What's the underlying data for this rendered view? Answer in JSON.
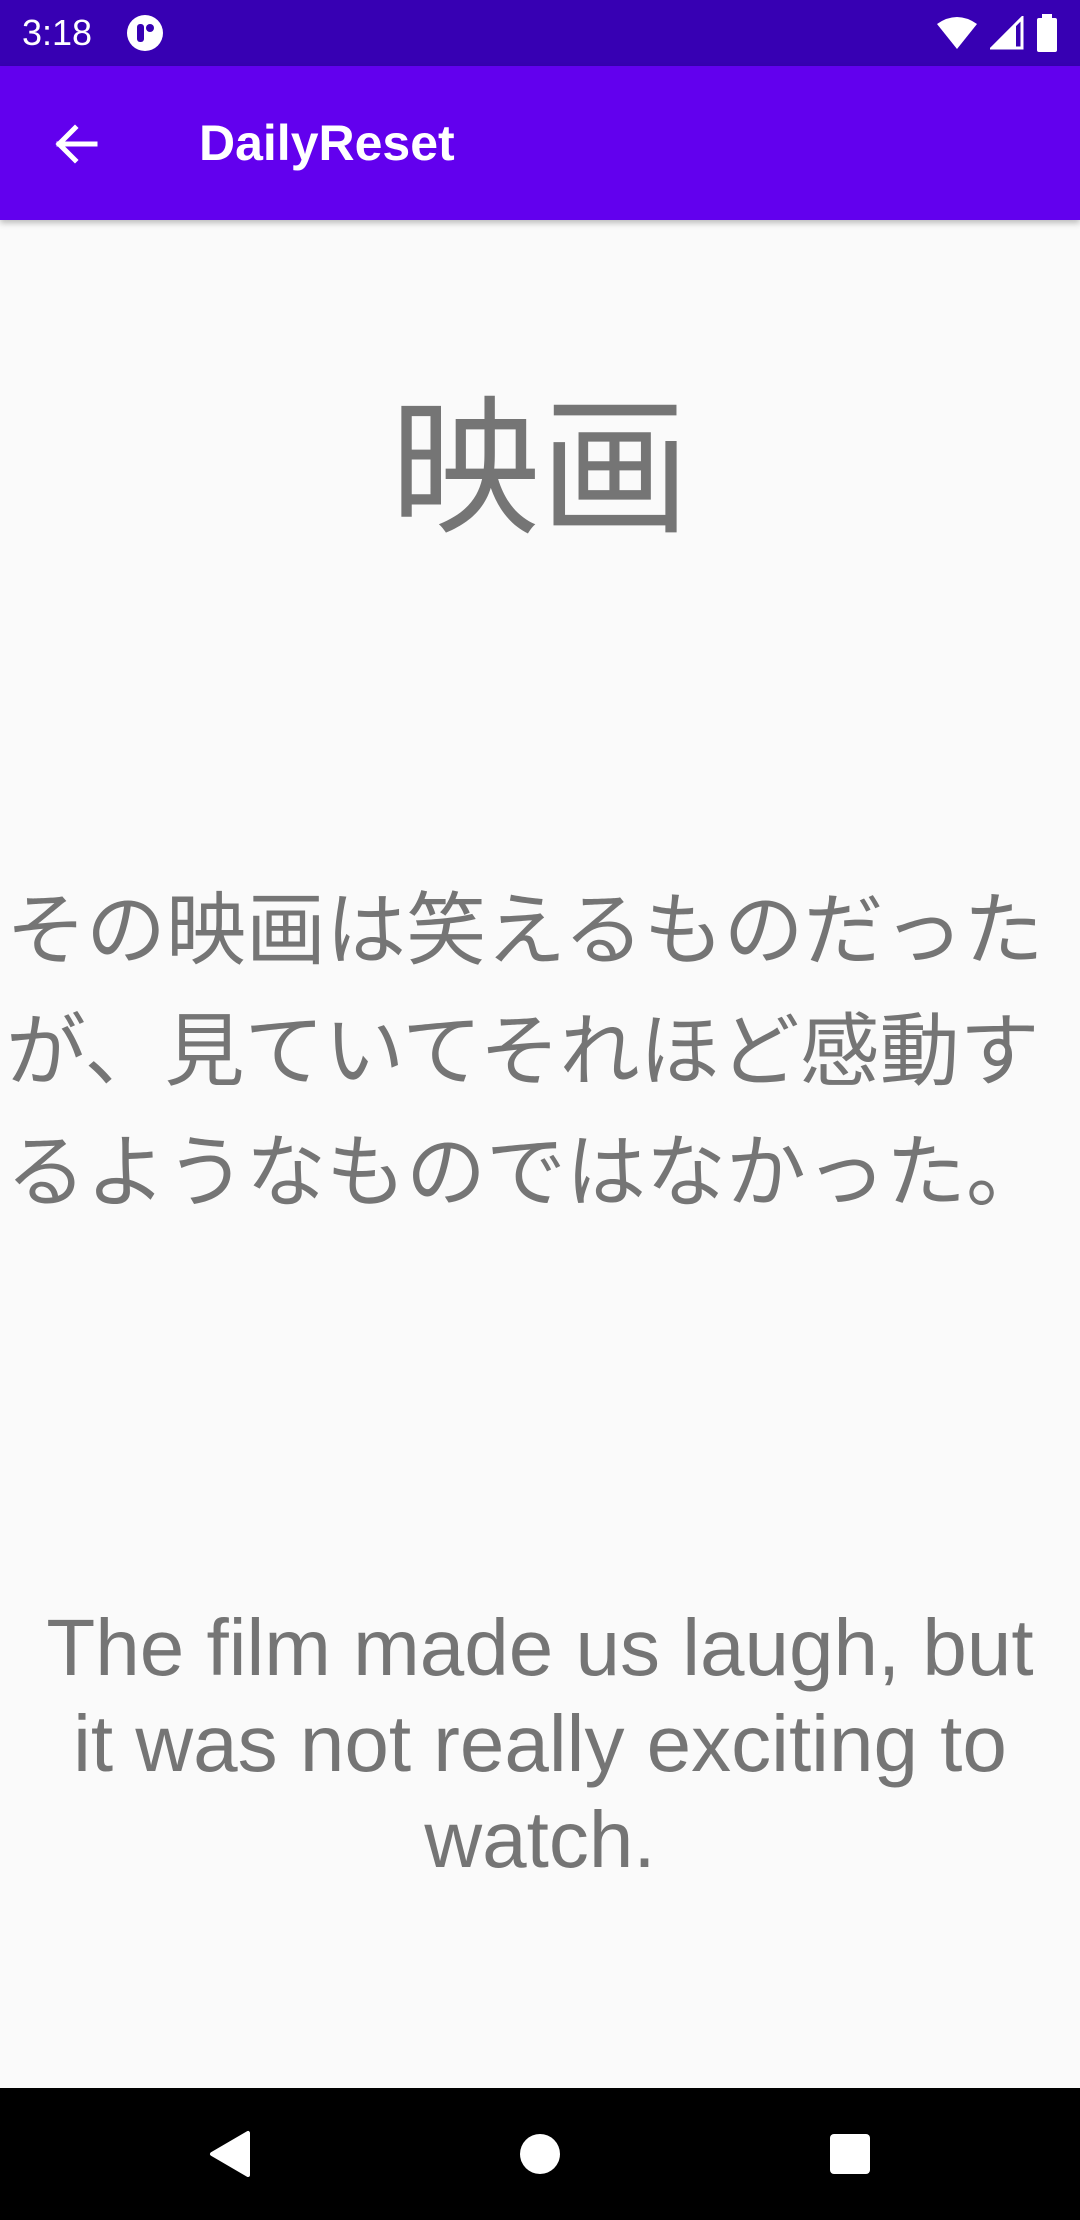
{
  "status_bar": {
    "time": "3:18",
    "icons": [
      "app-notification-icon",
      "wifi-icon",
      "signal-icon",
      "battery-icon"
    ]
  },
  "app_bar": {
    "title": "DailyReset",
    "back_icon": "arrow-back-icon"
  },
  "card": {
    "word": "映画",
    "sentence_jp": "その映画は笑えるものだったが、見ていてそれほど感動するようなものではなかった。",
    "sentence_en": "The film made us laugh, but it was not really exciting to watch."
  },
  "nav_bar": {
    "icons": [
      "back-triangle-icon",
      "home-circle-icon",
      "recents-square-icon"
    ]
  },
  "colors": {
    "status_bar": "#3700b3",
    "app_bar": "#6200ee",
    "background": "#fafafa",
    "text": "#757575",
    "nav_bar": "#000000"
  }
}
